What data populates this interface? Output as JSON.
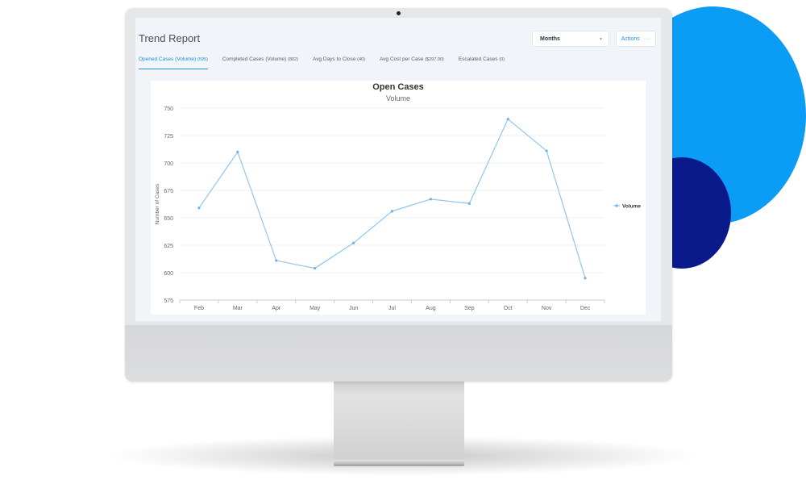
{
  "report": {
    "title": "Trend Report",
    "period_select": {
      "value": "Months",
      "icon": "chevron-down-icon"
    },
    "actions_button": {
      "label": "Actions",
      "icon": "more-horizontal-icon"
    },
    "tabs": [
      {
        "label": "Opened Cases (Volume)",
        "count": "(595)",
        "active": true
      },
      {
        "label": "Completed Cases (Volume)",
        "count": "(802)",
        "active": false
      },
      {
        "label": "Avg Days to Close",
        "count": "(40)",
        "active": false
      },
      {
        "label": "Avg Cost per Case",
        "count": "($297.00)",
        "active": false
      },
      {
        "label": "Escalated Cases",
        "count": "(0)",
        "active": false
      }
    ]
  },
  "chart_data": {
    "type": "line",
    "title": "Open Cases",
    "subtitle": "Volume",
    "ylabel": "Number of Cases",
    "categories": [
      "Feb",
      "Mar",
      "Apr",
      "May",
      "Jun",
      "Jul",
      "Aug",
      "Sep",
      "Oct",
      "Nov",
      "Dec"
    ],
    "series": [
      {
        "name": "Volume",
        "values": [
          659,
          710,
          611,
          604,
          627,
          656,
          667,
          663,
          740,
          711,
          595
        ]
      }
    ],
    "ylim": [
      575,
      750
    ],
    "yticks": [
      575,
      600,
      625,
      650,
      675,
      700,
      725,
      750
    ],
    "grid": true,
    "legend_position": "right",
    "line_color": "#90c6ee",
    "marker_color": "#6fb1e6"
  },
  "colors": {
    "accent": "#1f8fe0",
    "deco_circle_large": "#0b9cf5",
    "deco_circle_small": "#0a1a8a"
  }
}
